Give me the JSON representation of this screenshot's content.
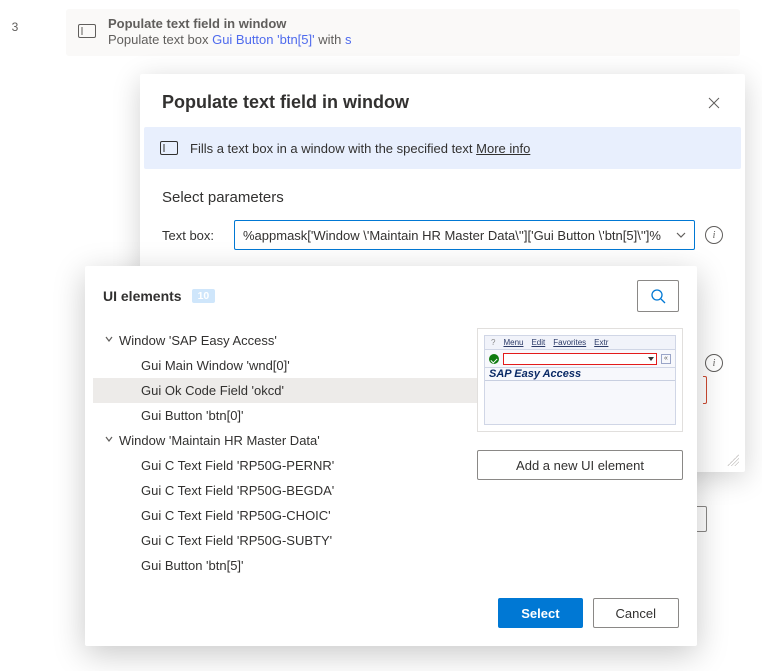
{
  "action_row": {
    "number": "3",
    "title": "Populate text field in window",
    "sub_prefix": "Populate text box ",
    "sub_link": "Gui Button 'btn[5]'",
    "sub_mid": " with ",
    "sub_suffix": "s"
  },
  "dialog": {
    "title": "Populate text field in window",
    "banner_text": "Fills a text box in a window with the specified text ",
    "banner_more": "More info",
    "section_title": "Select parameters",
    "param_label": "Text box:",
    "param_value": "%appmask['Window \\'Maintain HR Master Data\\'']['Gui Button \\'btn[5]\\'']%"
  },
  "popover": {
    "title": "UI elements",
    "badge": "10",
    "tree": {
      "roots": [
        {
          "label": "Window 'SAP Easy Access'",
          "children": [
            {
              "label": "Gui Main Window 'wnd[0]'",
              "selected": false
            },
            {
              "label": "Gui Ok Code Field 'okcd'",
              "selected": true
            },
            {
              "label": "Gui Button 'btn[0]'",
              "selected": false
            }
          ]
        },
        {
          "label": "Window 'Maintain HR Master Data'",
          "children": [
            {
              "label": "Gui C Text Field 'RP50G-PERNR'",
              "selected": false
            },
            {
              "label": "Gui C Text Field 'RP50G-BEGDA'",
              "selected": false
            },
            {
              "label": "Gui C Text Field 'RP50G-CHOIC'",
              "selected": false
            },
            {
              "label": "Gui C Text Field 'RP50G-SUBTY'",
              "selected": false
            },
            {
              "label": "Gui Button 'btn[5]'",
              "selected": false
            }
          ]
        }
      ]
    },
    "preview": {
      "menu_items": [
        "Menu",
        "Edit",
        "Favorites",
        "Extr"
      ],
      "expand": "«",
      "sap_title": "SAP Easy Access"
    },
    "add_label": "Add a new UI element",
    "select_label": "Select",
    "cancel_label": "Cancel"
  }
}
